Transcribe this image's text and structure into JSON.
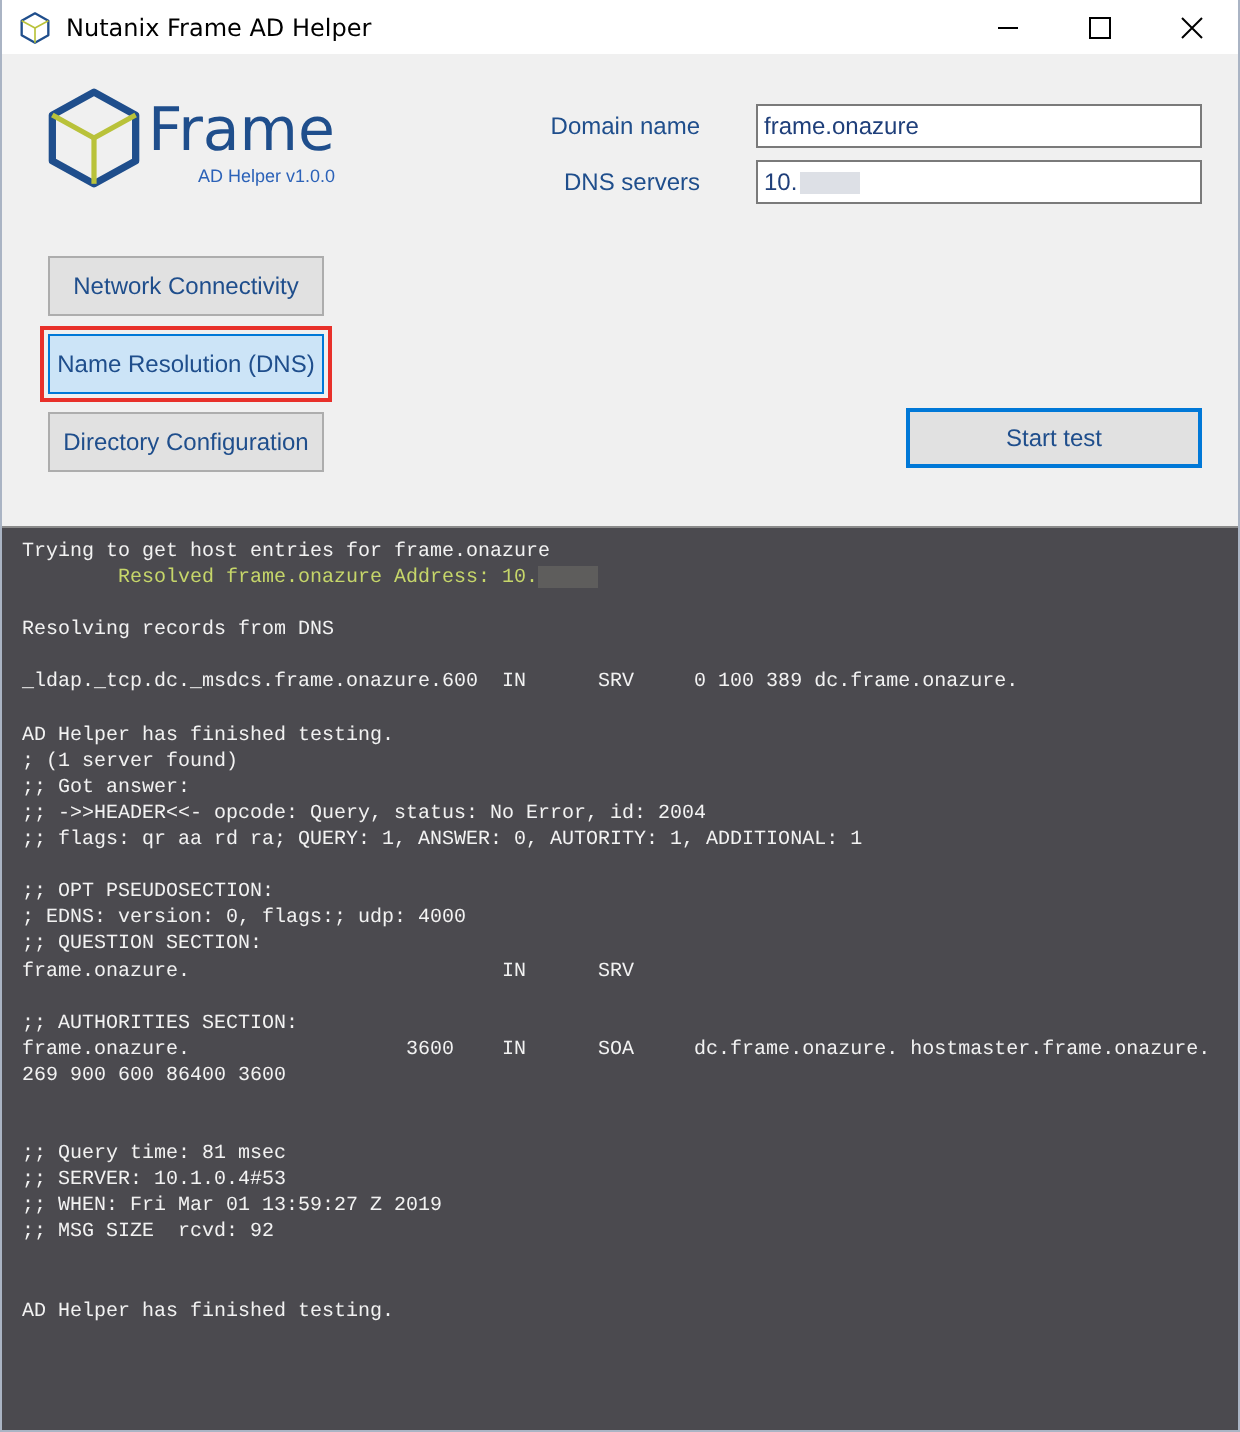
{
  "window": {
    "title": "Nutanix Frame AD Helper"
  },
  "logo": {
    "name": "Frame",
    "subtitle": "AD Helper v1.0.0"
  },
  "fields": [
    {
      "label": "Domain name",
      "value": "frame.onazure",
      "redacted": false
    },
    {
      "label": "DNS servers",
      "value": "10.",
      "redacted": true
    }
  ],
  "tests": [
    {
      "label": "Network Connectivity",
      "selected": false
    },
    {
      "label": "Name Resolution (DNS)",
      "selected": true
    },
    {
      "label": "Directory Configuration",
      "selected": false
    }
  ],
  "start_button": "Start test",
  "log": [
    {
      "kind": "normal",
      "text": "Trying to get host entries for frame.onazure"
    },
    {
      "kind": "success",
      "text": "Resolved frame.onazure Address: 10.",
      "redacted": true
    },
    {
      "kind": "blank"
    },
    {
      "kind": "normal",
      "text": "Resolving records from DNS"
    },
    {
      "kind": "blank"
    },
    {
      "kind": "normal",
      "text": "_ldap._tcp.dc._msdcs.frame.onazure.600  IN      SRV     0 100 389 dc.frame.onazure."
    },
    {
      "kind": "blank"
    },
    {
      "kind": "normal",
      "text": "AD Helper has finished testing."
    },
    {
      "kind": "normal",
      "text": "; (1 server found)"
    },
    {
      "kind": "normal",
      "text": ";; Got answer:"
    },
    {
      "kind": "normal",
      "text": ";; ->>HEADER<<- opcode: Query, status: No Error, id: 2004"
    },
    {
      "kind": "normal",
      "text": ";; flags: qr aa rd ra; QUERY: 1, ANSWER: 0, AUTORITY: 1, ADDITIONAL: 1"
    },
    {
      "kind": "blank"
    },
    {
      "kind": "normal",
      "text": ";; OPT PSEUDOSECTION:"
    },
    {
      "kind": "normal",
      "text": "; EDNS: version: 0, flags:; udp: 4000"
    },
    {
      "kind": "normal",
      "text": ";; QUESTION SECTION:"
    },
    {
      "kind": "normal",
      "text": "frame.onazure.                          IN      SRV"
    },
    {
      "kind": "blank"
    },
    {
      "kind": "normal",
      "text": ";; AUTHORITIES SECTION:"
    },
    {
      "kind": "normal",
      "text": "frame.onazure.                  3600    IN      SOA     dc.frame.onazure. hostmaster.frame.onazure."
    },
    {
      "kind": "normal",
      "text": "269 900 600 86400 3600"
    },
    {
      "kind": "blank"
    },
    {
      "kind": "blank"
    },
    {
      "kind": "normal",
      "text": ";; Query time: 81 msec"
    },
    {
      "kind": "normal",
      "text": ";; SERVER: 10.1.0.4#53"
    },
    {
      "kind": "normal",
      "text": ";; WHEN: Fri Mar 01 13:59:27 Z 2019"
    },
    {
      "kind": "normal",
      "text": ";; MSG SIZE  rcvd: 92"
    },
    {
      "kind": "blank"
    },
    {
      "kind": "blank"
    },
    {
      "kind": "normal",
      "text": "AD Helper has finished testing."
    }
  ]
}
